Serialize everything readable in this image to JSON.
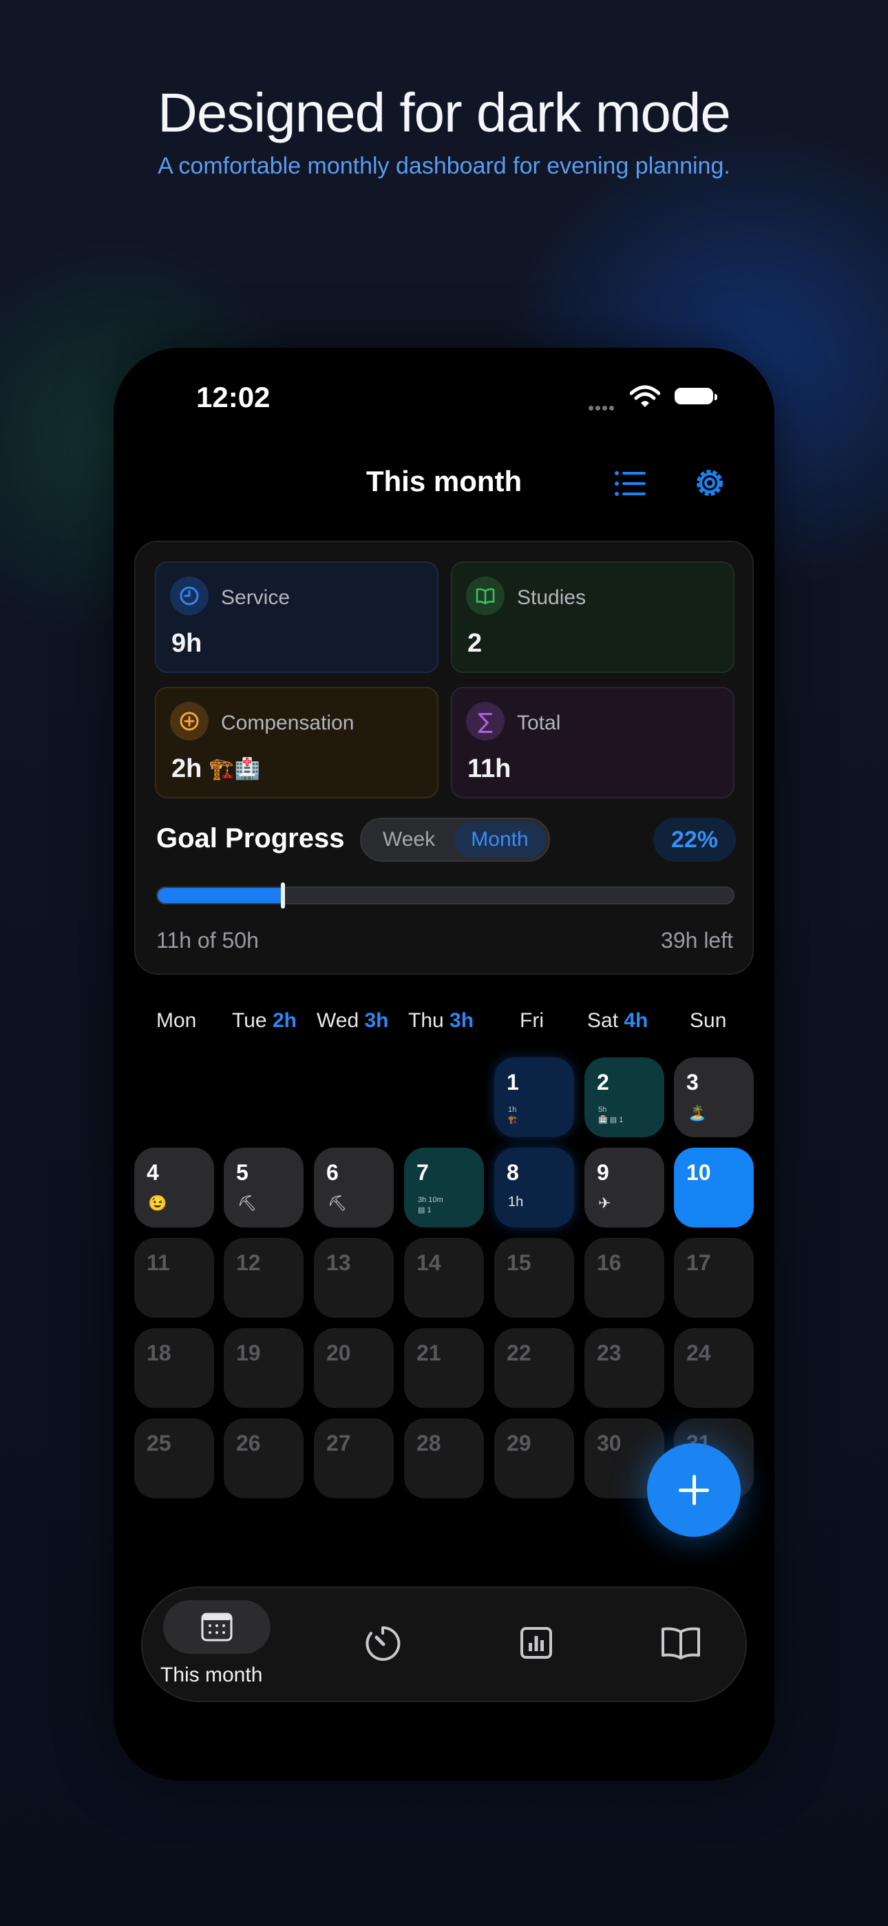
{
  "promo": {
    "headline": "Designed for dark mode",
    "subheadline": "A comfortable monthly dashboard for evening planning."
  },
  "status_bar": {
    "time": "12:02",
    "battery_level": 1.0
  },
  "nav": {
    "title": "This month",
    "list_icon": "list-icon",
    "settings_icon": "gear-icon"
  },
  "summary": {
    "service": {
      "label": "Service",
      "value": "9h",
      "icon": "clock-icon"
    },
    "studies": {
      "label": "Studies",
      "value": "2",
      "icon": "book-icon"
    },
    "compensation": {
      "label": "Compensation",
      "value": "2h",
      "emoji": "🏗️🏥",
      "icon": "plus-circle-icon"
    },
    "total": {
      "label": "Total",
      "value": "11h",
      "icon": "sigma-icon"
    }
  },
  "goal": {
    "title": "Goal Progress",
    "segments": [
      "Week",
      "Month"
    ],
    "selected": "Month",
    "percent_label": "22%",
    "progress": 0.22,
    "done_label": "11h of 50h",
    "left_label": "39h left"
  },
  "calendar": {
    "weekdays": [
      {
        "name": "Mon",
        "hours": ""
      },
      {
        "name": "Tue",
        "hours": "2h"
      },
      {
        "name": "Wed",
        "hours": "3h"
      },
      {
        "name": "Thu",
        "hours": "3h"
      },
      {
        "name": "Fri",
        "hours": ""
      },
      {
        "name": "Sat",
        "hours": "4h"
      },
      {
        "name": "Sun",
        "hours": ""
      }
    ],
    "days": {
      "d1": {
        "n": "1",
        "detail1": "1h",
        "detail2": "🏗️"
      },
      "d2": {
        "n": "2",
        "detail1": "5h",
        "detail2": "🏥 ▤ 1"
      },
      "d3": {
        "n": "3",
        "mark": "🏝️"
      },
      "d4": {
        "n": "4",
        "mark": "😉"
      },
      "d5": {
        "n": "5",
        "mark": "⛏"
      },
      "d6": {
        "n": "6",
        "mark": "⛏"
      },
      "d7": {
        "n": "7",
        "detail1": "3h 10m",
        "detail2": "▤ 1"
      },
      "d8": {
        "n": "8",
        "mark": "1h"
      },
      "d9": {
        "n": "9",
        "mark": "✈"
      },
      "d10": {
        "n": "10"
      }
    },
    "future_days": [
      "11",
      "12",
      "13",
      "14",
      "15",
      "16",
      "17",
      "18",
      "19",
      "20",
      "21",
      "22",
      "23",
      "24",
      "25",
      "26",
      "27",
      "28",
      "29",
      "30",
      "31"
    ]
  },
  "fab": {
    "icon": "plus-icon"
  },
  "tabbar": {
    "active_label": "This month",
    "tabs": [
      "calendar-icon",
      "timer-icon",
      "chart-icon",
      "book-icon"
    ]
  }
}
